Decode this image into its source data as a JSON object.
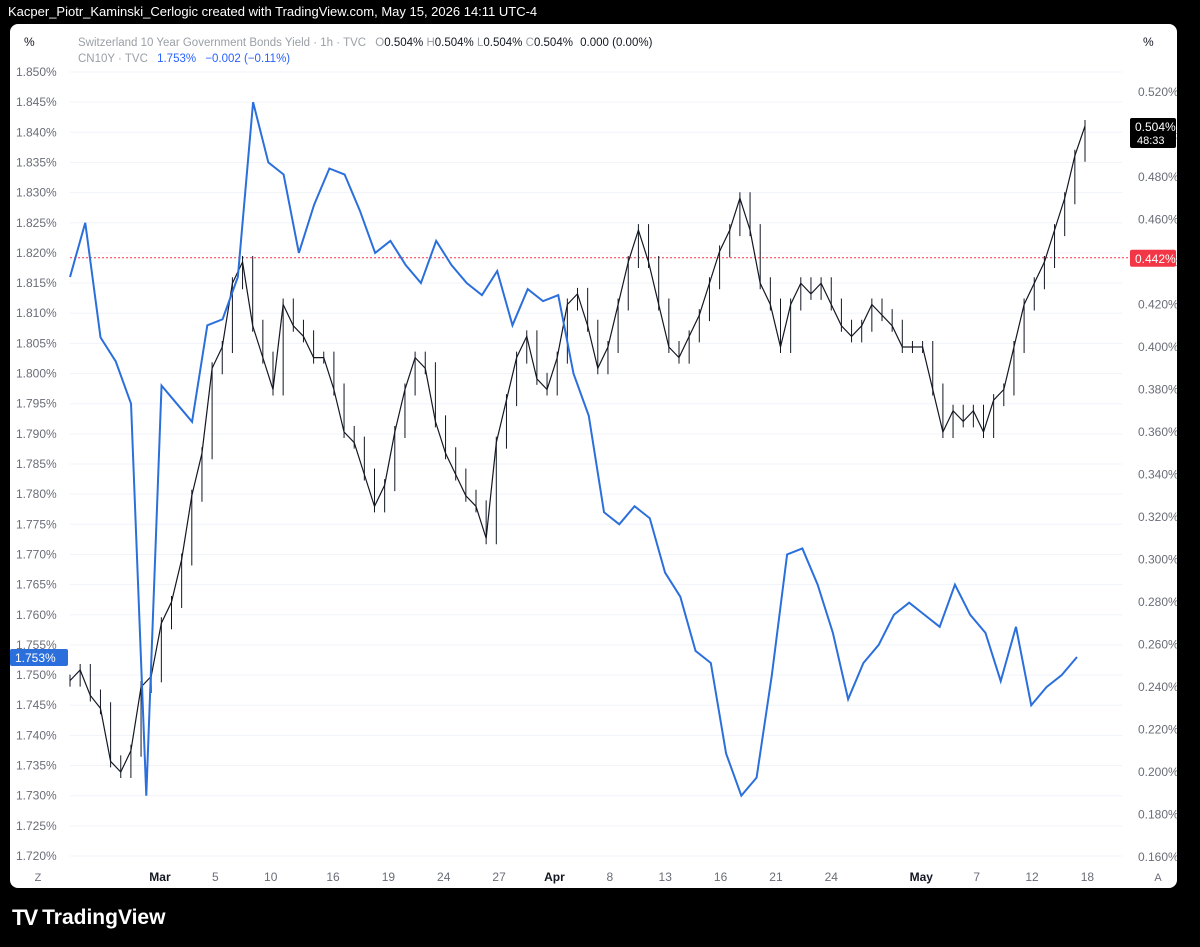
{
  "header": {
    "title": "Kacper_Piotr_Kaminski_Cerlogic created with TradingView.com, May 15, 2026 14:11 UTC-4"
  },
  "legend": {
    "main_name": "Switzerland 10 Year Government Bonds Yield · 1h · TVC",
    "o_label": "O",
    "o_val": "0.504%",
    "h_label": "H",
    "h_val": "0.504%",
    "l_label": "L",
    "l_val": "0.504%",
    "c_label": "C",
    "c_val": "0.504%",
    "change": "0.000 (0.00%)",
    "comp_name": "CN10Y · TVC",
    "comp_val": "1.753%",
    "comp_change": "−0.002 (−0.11%)"
  },
  "units": {
    "left": "%",
    "right": "%"
  },
  "corner": {
    "left": "Z",
    "right": "A"
  },
  "brand": {
    "name": "TradingView"
  },
  "colors": {
    "black_series": "#131722",
    "blue_series": "#2b6fdc",
    "red_line": "#f23645",
    "grid": "#f0f3fa"
  },
  "chart_data": {
    "type": "line",
    "left_axis": {
      "ticks": [
        "1.720%",
        "1.725%",
        "1.730%",
        "1.735%",
        "1.740%",
        "1.745%",
        "1.750%",
        "1.755%",
        "1.760%",
        "1.765%",
        "1.770%",
        "1.775%",
        "1.780%",
        "1.785%",
        "1.790%",
        "1.795%",
        "1.800%",
        "1.805%",
        "1.810%",
        "1.815%",
        "1.820%",
        "1.825%",
        "1.830%",
        "1.835%",
        "1.840%",
        "1.845%",
        "1.850%"
      ],
      "range": [
        1.72,
        1.85
      ]
    },
    "right_axis": {
      "ticks": [
        "0.160%",
        "0.180%",
        "0.200%",
        "0.220%",
        "0.240%",
        "0.260%",
        "0.280%",
        "0.300%",
        "0.320%",
        "0.340%",
        "0.360%",
        "0.380%",
        "0.400%",
        "0.420%",
        "0.440%",
        "0.460%",
        "0.480%",
        "0.500%",
        "0.520%"
      ],
      "range": [
        0.16,
        0.52
      ]
    },
    "x_labels": [
      {
        "label": "Mar",
        "bold": true,
        "idx": 6.5
      },
      {
        "label": "5",
        "idx": 10.5
      },
      {
        "label": "10",
        "idx": 14.5
      },
      {
        "label": "16",
        "idx": 19
      },
      {
        "label": "19",
        "idx": 23
      },
      {
        "label": "24",
        "idx": 27
      },
      {
        "label": "27",
        "idx": 31
      },
      {
        "label": "Apr",
        "bold": true,
        "idx": 35
      },
      {
        "label": "8",
        "idx": 39
      },
      {
        "label": "13",
        "idx": 43
      },
      {
        "label": "16",
        "idx": 47
      },
      {
        "label": "21",
        "idx": 51
      },
      {
        "label": "24",
        "idx": 55
      },
      {
        "label": "May",
        "bold": true,
        "idx": 61.5
      },
      {
        "label": "7",
        "idx": 65.5
      },
      {
        "label": "12",
        "idx": 69.5
      },
      {
        "label": "18",
        "idx": 73.5
      }
    ],
    "x_range": [
      0,
      76
    ],
    "series": [
      {
        "name": "Switzerland 10 Year Government Bonds Yield",
        "axis": "right",
        "values": [
          0.243,
          0.248,
          0.236,
          0.23,
          0.205,
          0.2,
          0.21,
          0.24,
          0.245,
          0.27,
          0.28,
          0.3,
          0.33,
          0.35,
          0.39,
          0.4,
          0.43,
          0.44,
          0.41,
          0.395,
          0.38,
          0.42,
          0.41,
          0.405,
          0.395,
          0.395,
          0.38,
          0.36,
          0.355,
          0.34,
          0.325,
          0.335,
          0.36,
          0.38,
          0.395,
          0.39,
          0.365,
          0.35,
          0.34,
          0.33,
          0.325,
          0.31,
          0.355,
          0.375,
          0.395,
          0.405,
          0.385,
          0.38,
          0.395,
          0.42,
          0.425,
          0.41,
          0.39,
          0.4,
          0.42,
          0.44,
          0.455,
          0.44,
          0.42,
          0.4,
          0.395,
          0.405,
          0.415,
          0.43,
          0.445,
          0.455,
          0.47,
          0.455,
          0.43,
          0.42,
          0.4,
          0.42,
          0.43,
          0.425,
          0.43,
          0.42,
          0.41,
          0.405,
          0.41,
          0.42,
          0.415,
          0.41,
          0.4,
          0.4,
          0.4,
          0.38,
          0.36,
          0.37,
          0.365,
          0.37,
          0.36,
          0.375,
          0.38,
          0.4,
          0.42,
          0.43,
          0.44,
          0.455,
          0.47,
          0.49,
          0.504
        ]
      },
      {
        "name": "CN10Y",
        "axis": "left",
        "values": [
          1.816,
          1.825,
          1.806,
          1.802,
          1.795,
          1.73,
          1.798,
          1.795,
          1.792,
          1.808,
          1.809,
          1.816,
          1.845,
          1.835,
          1.833,
          1.82,
          1.828,
          1.834,
          1.833,
          1.827,
          1.82,
          1.822,
          1.818,
          1.815,
          1.822,
          1.818,
          1.815,
          1.813,
          1.817,
          1.808,
          1.814,
          1.812,
          1.813,
          1.8,
          1.793,
          1.777,
          1.775,
          1.778,
          1.776,
          1.767,
          1.763,
          1.754,
          1.752,
          1.737,
          1.73,
          1.733,
          1.75,
          1.77,
          1.771,
          1.765,
          1.757,
          1.746,
          1.752,
          1.755,
          1.76,
          1.762,
          1.76,
          1.758,
          1.765,
          1.76,
          1.757,
          1.749,
          1.758,
          1.745,
          1.748,
          1.75,
          1.753
        ]
      }
    ],
    "reference_line": {
      "value": 0.442,
      "axis": "right"
    },
    "price_tags": [
      {
        "text": "1.753%",
        "side": "left",
        "value": 1.753,
        "axis": "left"
      },
      {
        "text": "0.442%",
        "side": "right",
        "value": 0.442,
        "axis": "right"
      },
      {
        "text": "0.504%",
        "sub": "48:33",
        "side": "right",
        "value": 0.504,
        "axis": "right"
      }
    ]
  }
}
